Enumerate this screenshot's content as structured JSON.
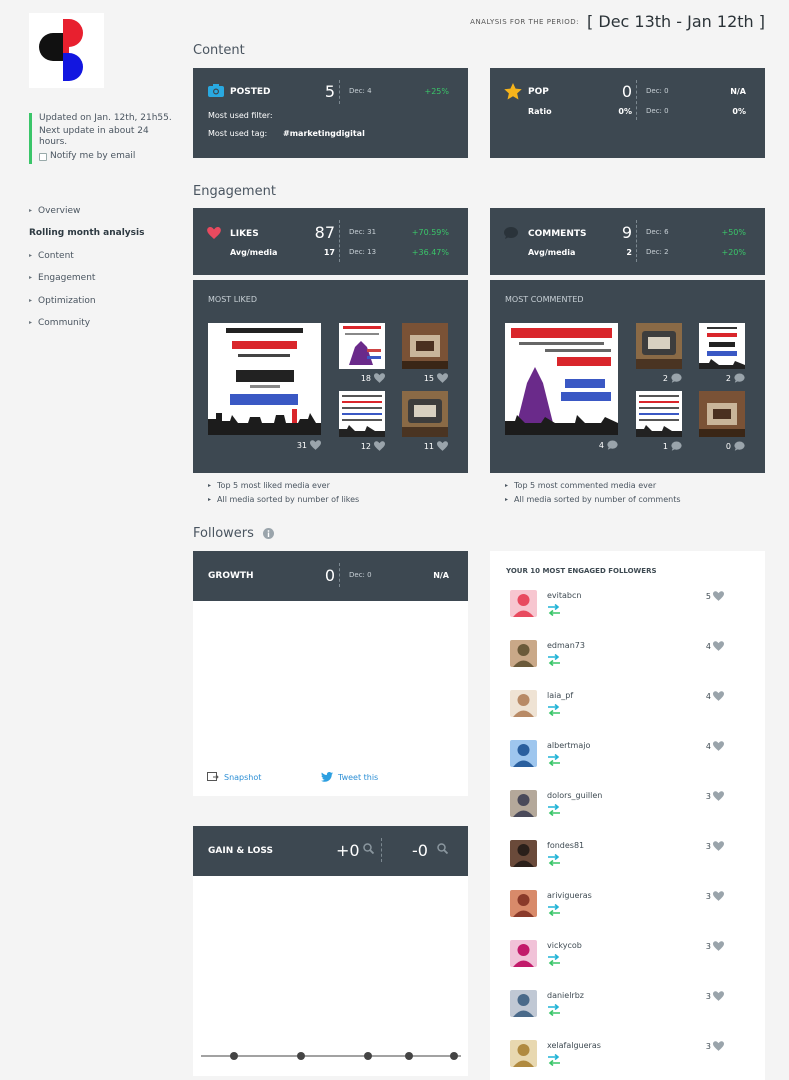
{
  "brand": {
    "colors": {
      "accent_green": "#3ac569",
      "panel": "#3d4851",
      "like_red": "#e84a5f",
      "link_blue": "#2d8fd5",
      "star_gold": "#f5b31b"
    }
  },
  "sidebar": {
    "updated": "Updated on Jan. 12th, 21h55.",
    "next_update": "Next update in about 24 hours.",
    "notify_label": "Notify me by email",
    "nav": [
      {
        "label": "Overview",
        "bullet": true
      },
      {
        "label": "Rolling month analysis",
        "bullet": false
      },
      {
        "label": "Content",
        "bullet": true
      },
      {
        "label": "Engagement",
        "bullet": true
      },
      {
        "label": "Optimization",
        "bullet": true
      },
      {
        "label": "Community",
        "bullet": true
      }
    ]
  },
  "header": {
    "period_label": "ANALYSIS FOR THE PERIOD:",
    "period_value": "[ Dec 13th - Jan 12th ]"
  },
  "content": {
    "title": "Content",
    "posted": {
      "label": "POSTED",
      "value": "5",
      "prev": "Dec: 4",
      "change": "+25%",
      "filter_label": "Most used filter:",
      "tag_label": "Most used tag:",
      "tag_value": "#marketingdigital"
    },
    "pop": {
      "label": "POP",
      "value": "0",
      "prev": "Dec: 0",
      "change": "N/A",
      "ratio_label": "Ratio",
      "ratio_value": "0%",
      "ratio_prev": "Dec: 0",
      "ratio_change": "0%"
    }
  },
  "engagement": {
    "title": "Engagement",
    "likes": {
      "label": "LIKES",
      "value": "87",
      "prev": "Dec: 31",
      "change": "+70.59%",
      "avg_label": "Avg/media",
      "avg_value": "17",
      "avg_prev": "Dec: 13",
      "avg_change": "+36.47%"
    },
    "comments": {
      "label": "COMMENTS",
      "value": "9",
      "prev": "Dec: 6",
      "change": "+50%",
      "avg_label": "Avg/media",
      "avg_value": "2",
      "avg_prev": "Dec: 2",
      "avg_change": "+20%"
    },
    "most_liked": {
      "title": "MOST LIKED",
      "counts": [
        "31",
        "18",
        "15",
        "12",
        "11"
      ]
    },
    "most_commented": {
      "title": "MOST COMMENTED",
      "counts": [
        "4",
        "2",
        "2",
        "1",
        "0"
      ]
    },
    "liked_notes": [
      "Top 5 most liked media ever",
      "All media sorted by number of likes"
    ],
    "commented_notes": [
      "Top 5 most commented media ever",
      "All media sorted by number of comments"
    ]
  },
  "followers": {
    "title": "Followers",
    "growth": {
      "label": "GROWTH",
      "value": "0",
      "prev": "Dec: 0",
      "change": "N/A",
      "snapshot": "Snapshot",
      "tweet": "Tweet this"
    },
    "gain_loss": {
      "label": "GAIN & LOSS",
      "gain": "+0",
      "loss": "-0"
    },
    "engaged": {
      "title": "YOUR 10 MOST ENGAGED FOLLOWERS",
      "list": [
        {
          "name": "evitabcn",
          "score": "5"
        },
        {
          "name": "edman73",
          "score": "4"
        },
        {
          "name": "laia_pf",
          "score": "4"
        },
        {
          "name": "albertmajo",
          "score": "4"
        },
        {
          "name": "dolors_guillen",
          "score": "3"
        },
        {
          "name": "fondes81",
          "score": "3"
        },
        {
          "name": "arivigueras",
          "score": "3"
        },
        {
          "name": "vickycob",
          "score": "3"
        },
        {
          "name": "danielrbz",
          "score": "3"
        },
        {
          "name": "xelafalgueras",
          "score": "3"
        }
      ]
    }
  }
}
